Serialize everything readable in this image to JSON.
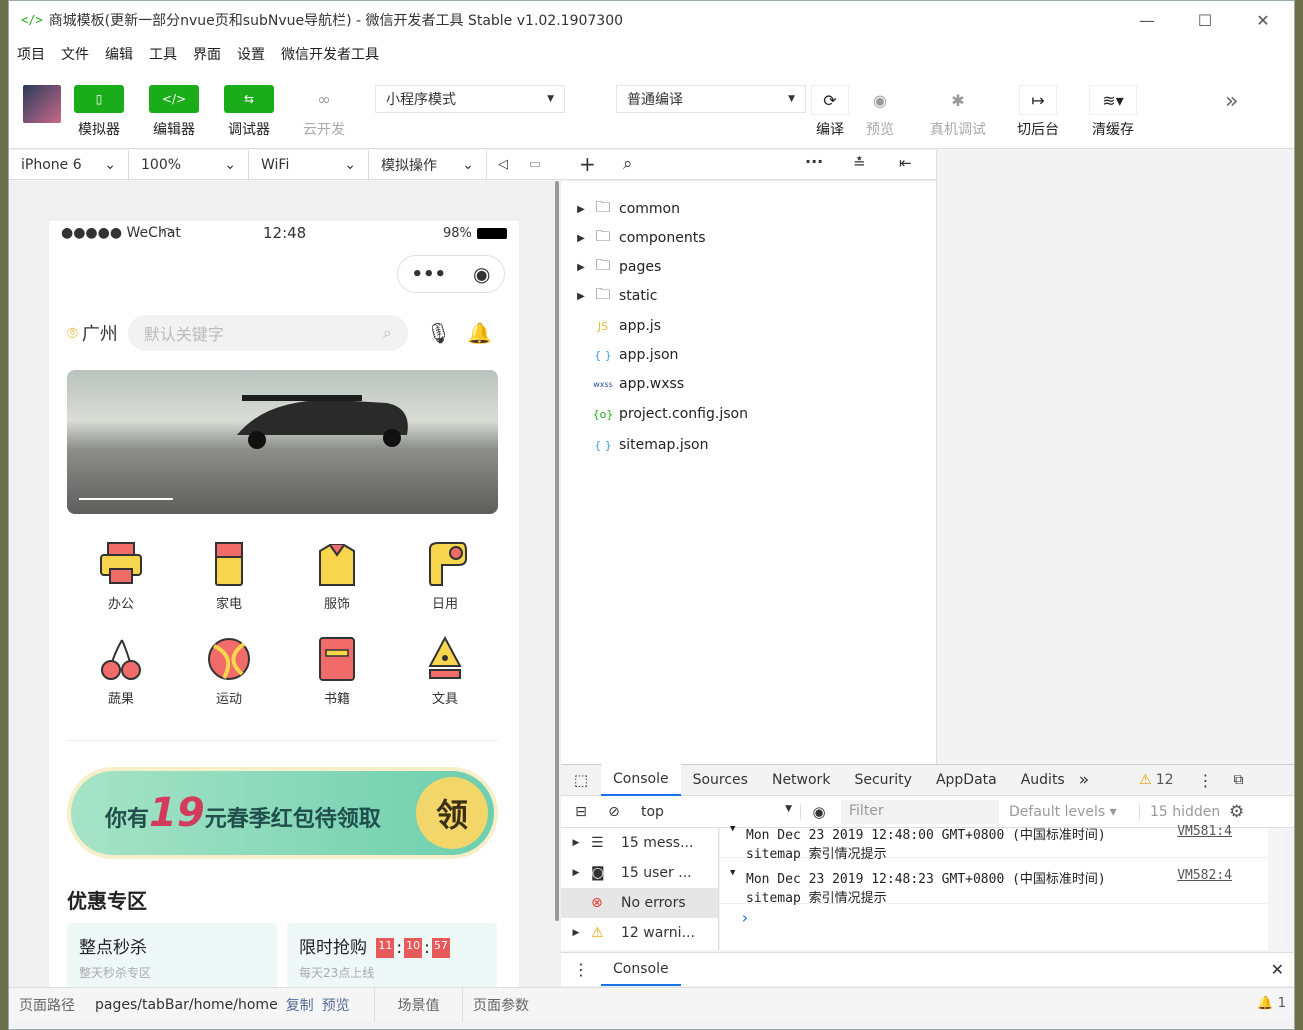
{
  "window": {
    "title": "商城模板(更新一部分nvue页和subNvue导航栏) - 微信开发者工具 Stable v1.02.1907300",
    "app_icon": "</>"
  },
  "menu": [
    "项目",
    "文件",
    "编辑",
    "工具",
    "界面",
    "设置",
    "微信开发者工具"
  ],
  "toolbar": {
    "simulator": "模拟器",
    "editor": "编辑器",
    "debugger": "调试器",
    "cloud": "云开发",
    "mode": "小程序模式",
    "compile_mode": "普通编译",
    "compile": "编译",
    "preview": "预览",
    "remote_debug": "真机调试",
    "background": "切后台",
    "clear_cache": "清缓存",
    "simulator_icon": "▯",
    "editor_icon": "</>",
    "debugger_icon": "⇆"
  },
  "simbar": {
    "device": "iPhone 6",
    "zoom": "100%",
    "network": "WiFi",
    "sim_ops": "模拟操作"
  },
  "phone": {
    "status": {
      "carrier": "●●●●● WeChat",
      "time": "12:48",
      "battery": "98%"
    },
    "city": "广州",
    "search_placeholder": "默认关键字",
    "categories": [
      {
        "label": "办公",
        "icon": "printer-icon"
      },
      {
        "label": "家电",
        "icon": "fridge-icon"
      },
      {
        "label": "服饰",
        "icon": "shirt-icon"
      },
      {
        "label": "日用",
        "icon": "tissue-icon"
      },
      {
        "label": "蔬果",
        "icon": "cherry-icon"
      },
      {
        "label": "运动",
        "icon": "ball-icon"
      },
      {
        "label": "书籍",
        "icon": "book-icon"
      },
      {
        "label": "文具",
        "icon": "pen-icon"
      }
    ],
    "redpack": {
      "prefix": "你有",
      "amount": "19",
      "suffix": "元春季红包待领取",
      "button": "领"
    },
    "section_title": "优惠专区",
    "promo1": {
      "title": "整点秒杀",
      "subtitle": "整天秒杀专区"
    },
    "promo2": {
      "title": "限时抢购",
      "subtitle": "每天23点上线",
      "timer": [
        "11",
        "10",
        "57"
      ]
    }
  },
  "pathbar": {
    "label": "页面路径",
    "path": "pages/tabBar/home/home",
    "copy": "复制",
    "preview": "预览",
    "scene": "场景值",
    "params": "页面参数"
  },
  "files": [
    {
      "name": "common",
      "type": "folder"
    },
    {
      "name": "components",
      "type": "folder"
    },
    {
      "name": "pages",
      "type": "folder"
    },
    {
      "name": "static",
      "type": "folder"
    },
    {
      "name": "app.js",
      "type": "js",
      "badge": "JS"
    },
    {
      "name": "app.json",
      "type": "json",
      "badge": "{ }"
    },
    {
      "name": "app.wxss",
      "type": "wxss",
      "badge": "wxss"
    },
    {
      "name": "project.config.json",
      "type": "config",
      "badge": "{o}"
    },
    {
      "name": "sitemap.json",
      "type": "json",
      "badge": "{ }"
    }
  ],
  "devtools": {
    "tabs": [
      "Console",
      "Sources",
      "Network",
      "Security",
      "AppData",
      "Audits"
    ],
    "active_tab": "Console",
    "warn_count": "12",
    "context": "top",
    "filter_placeholder": "Filter",
    "levels": "Default levels",
    "hidden": "15 hidden",
    "sidebar": [
      {
        "label": "15 mess...",
        "icon": "list-icon"
      },
      {
        "label": "15 user ...",
        "icon": "user-icon"
      },
      {
        "label": "No errors",
        "icon": "error-icon"
      },
      {
        "label": "12 warni...",
        "icon": "warning-icon"
      }
    ],
    "logs": [
      {
        "time": "Mon Dec 23 2019 12:48:00 GMT+0800 (中国标准时间)",
        "msg": "sitemap 索引情况提示",
        "src": "VM581:4"
      },
      {
        "time": "Mon Dec 23 2019 12:48:23 GMT+0800 (中国标准时间)",
        "msg": "sitemap 索引情况提示",
        "src": "VM582:4"
      }
    ],
    "prompt": "›",
    "drawer_tab": "Console",
    "notif_count": "1"
  },
  "colors": {
    "accent": "#1aad19",
    "link": "#1a73e8",
    "red": "#e85a5a"
  }
}
